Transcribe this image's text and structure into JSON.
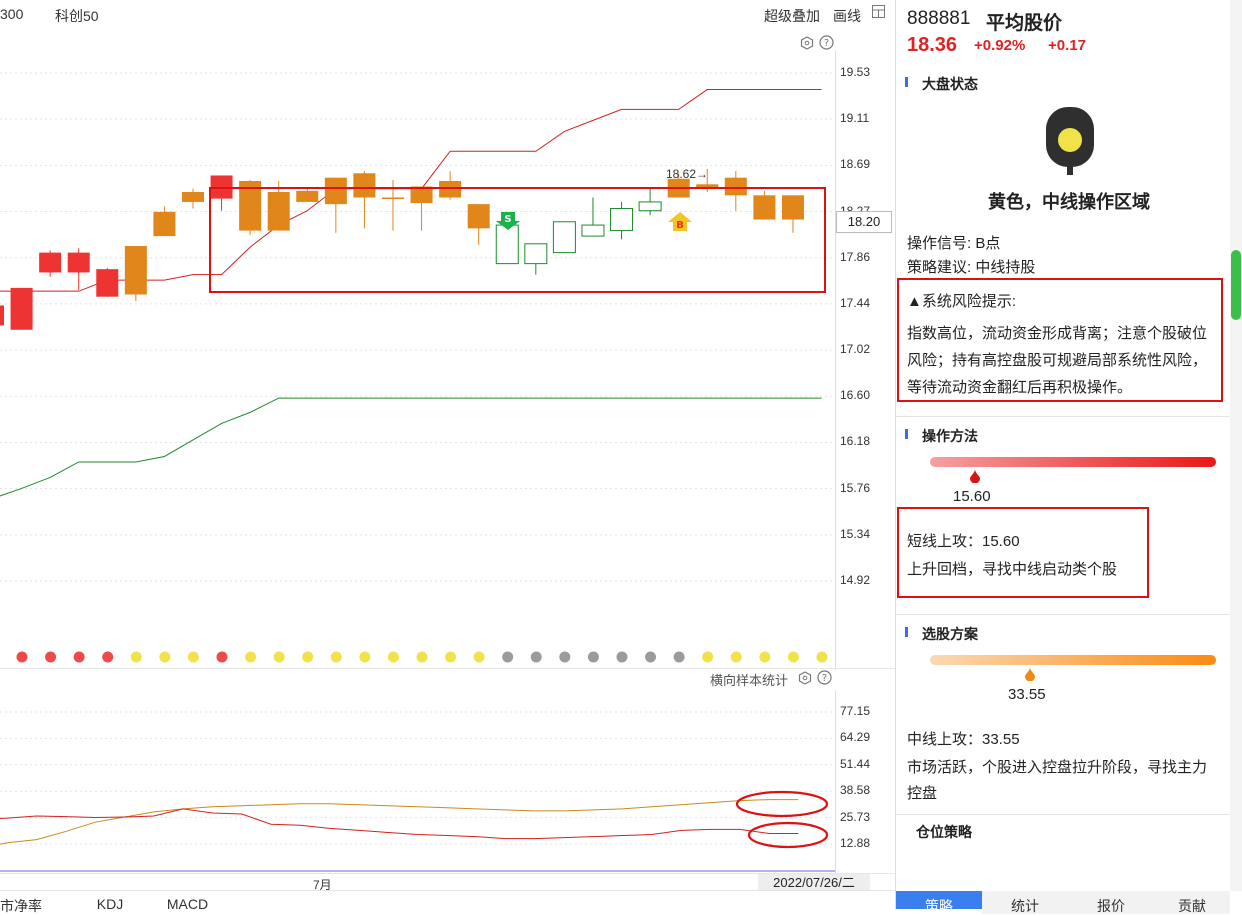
{
  "toolbar": {
    "left_cut": "300",
    "kechuang": "科创50",
    "overlay": "超级叠加",
    "draw": "画线"
  },
  "stock": {
    "code": "888881",
    "name": "平均股价",
    "price": "18.36",
    "pct": "+0.92%",
    "change": "+0.17"
  },
  "main_chart": {
    "y_ticks": [
      "19.53",
      "19.11",
      "18.69",
      "18.27",
      "17.86",
      "17.44",
      "17.02",
      "16.60",
      "16.18",
      "15.76",
      "15.34",
      "14.92"
    ],
    "current_price_label": "18.20",
    "high_annotation": "18.62→",
    "sell_marker": "S",
    "buy_marker": "B"
  },
  "chart_data": {
    "type": "candlestick",
    "ylim": [
      14.92,
      19.53
    ],
    "candles": [
      {
        "o": 17.42,
        "c": 17.24,
        "h": 17.44,
        "l": 17.18,
        "color": "red"
      },
      {
        "o": 17.2,
        "c": 17.58,
        "h": 17.58,
        "l": 17.2,
        "color": "red"
      },
      {
        "o": 17.72,
        "c": 17.9,
        "h": 17.92,
        "l": 17.68,
        "color": "red"
      },
      {
        "o": 17.72,
        "c": 17.9,
        "h": 17.94,
        "l": 17.56,
        "color": "red"
      },
      {
        "o": 17.5,
        "c": 17.75,
        "h": 17.76,
        "l": 17.5,
        "color": "red"
      },
      {
        "o": 17.52,
        "c": 17.96,
        "h": 17.96,
        "l": 17.46,
        "color": "orange"
      },
      {
        "o": 18.05,
        "c": 18.27,
        "h": 18.32,
        "l": 18.05,
        "color": "orange"
      },
      {
        "o": 18.36,
        "c": 18.45,
        "h": 18.48,
        "l": 18.3,
        "color": "orange"
      },
      {
        "o": 18.39,
        "c": 18.6,
        "h": 18.6,
        "l": 18.28,
        "color": "red"
      },
      {
        "o": 18.55,
        "c": 18.1,
        "h": 18.56,
        "l": 18.06,
        "color": "orange"
      },
      {
        "o": 18.45,
        "c": 18.1,
        "h": 18.55,
        "l": 18.1,
        "color": "orange"
      },
      {
        "o": 18.46,
        "c": 18.36,
        "h": 18.48,
        "l": 18.36,
        "color": "orange"
      },
      {
        "o": 18.58,
        "c": 18.34,
        "h": 18.58,
        "l": 18.08,
        "color": "orange"
      },
      {
        "o": 18.62,
        "c": 18.4,
        "h": 18.64,
        "l": 18.12,
        "color": "orange"
      },
      {
        "o": 18.4,
        "c": 18.4,
        "h": 18.56,
        "l": 18.1,
        "color": "orange_doji"
      },
      {
        "o": 18.5,
        "c": 18.35,
        "h": 18.5,
        "l": 18.1,
        "color": "orange"
      },
      {
        "o": 18.55,
        "c": 18.4,
        "h": 18.64,
        "l": 18.38,
        "color": "orange"
      },
      {
        "o": 18.34,
        "c": 18.12,
        "h": 18.34,
        "l": 17.97,
        "color": "orange"
      },
      {
        "o": 17.8,
        "c": 18.15,
        "h": 18.16,
        "l": 17.8,
        "color": "green"
      },
      {
        "o": 17.8,
        "c": 17.98,
        "h": 17.98,
        "l": 17.7,
        "color": "green"
      },
      {
        "o": 17.9,
        "c": 18.18,
        "h": 18.18,
        "l": 17.9,
        "color": "green"
      },
      {
        "o": 18.05,
        "c": 18.15,
        "h": 18.4,
        "l": 18.05,
        "color": "green"
      },
      {
        "o": 18.1,
        "c": 18.3,
        "h": 18.36,
        "l": 18.02,
        "color": "green"
      },
      {
        "o": 18.28,
        "c": 18.36,
        "h": 18.48,
        "l": 18.24,
        "color": "green"
      },
      {
        "o": 18.57,
        "c": 18.4,
        "h": 18.62,
        "l": 18.4,
        "color": "orange"
      },
      {
        "o": 18.52,
        "c": 18.49,
        "h": 18.66,
        "l": 18.45,
        "color": "orange_doji"
      },
      {
        "o": 18.58,
        "c": 18.42,
        "h": 18.64,
        "l": 18.28,
        "color": "orange"
      },
      {
        "o": 18.42,
        "c": 18.2,
        "h": 18.46,
        "l": 18.2,
        "color": "orange"
      },
      {
        "o": 18.42,
        "c": 18.2,
        "h": 18.42,
        "l": 18.08,
        "color": "orange"
      }
    ],
    "red_line": [
      17.55,
      17.55,
      17.55,
      17.55,
      17.65,
      17.65,
      17.65,
      17.7,
      17.7,
      17.95,
      18.15,
      18.28,
      18.48,
      18.48,
      18.48,
      18.48,
      18.82,
      18.82,
      18.82,
      18.82,
      19.0,
      19.1,
      19.2,
      19.2,
      19.2,
      19.38,
      19.38,
      19.38,
      19.38,
      19.38
    ],
    "green_line": [
      15.67,
      15.76,
      15.86,
      16.0,
      16.0,
      16.0,
      16.05,
      16.2,
      16.35,
      16.45,
      16.58,
      16.58,
      16.58,
      16.58,
      16.58,
      16.58,
      16.58,
      16.58,
      16.58,
      16.58,
      16.58,
      16.58,
      16.58,
      16.58,
      16.58,
      16.58,
      16.58,
      16.58,
      16.58,
      16.58
    ],
    "dots": [
      "red",
      "red",
      "red",
      "red",
      "yellow",
      "yellow",
      "yellow",
      "red",
      "yellow",
      "yellow",
      "yellow",
      "yellow",
      "yellow",
      "yellow",
      "yellow",
      "yellow",
      "yellow",
      "gray",
      "gray",
      "gray",
      "gray",
      "gray",
      "gray",
      "gray",
      "yellow",
      "yellow",
      "yellow",
      "yellow",
      "yellow"
    ],
    "sub_ylim": [
      12.88,
      77.15
    ],
    "sub_red": [
      25.0,
      25.5,
      26.5,
      26.2,
      25.8,
      26.0,
      26.5,
      30.0,
      28.0,
      27.5,
      22.5,
      22.0,
      20.5,
      19.5,
      18.5,
      17.5,
      17.0,
      16.5,
      15.5,
      15.5,
      16.0,
      16.5,
      17.0,
      17.5,
      19.5,
      20.0,
      20.0,
      18.0,
      18.0
    ],
    "sub_orange": [
      10.5,
      13.5,
      15.0,
      19.0,
      23.5,
      26.0,
      28.5,
      30.0,
      31.0,
      31.5,
      32.0,
      32.5,
      32.5,
      32.0,
      31.5,
      31.0,
      30.5,
      30.0,
      29.5,
      29.0,
      29.0,
      29.5,
      30.0,
      31.0,
      32.0,
      33.0,
      34.0,
      34.5,
      34.5
    ]
  },
  "sub_chart": {
    "title": "横向样本统计",
    "y_ticks": [
      "77.15",
      "64.29",
      "51.44",
      "38.58",
      "25.73",
      "12.88"
    ],
    "x_label": "7月",
    "date_label": "2022/07/26/二"
  },
  "bottom_tabs_left": [
    "市净率",
    "KDJ",
    "MACD"
  ],
  "panel": {
    "market_title": "大盘状态",
    "status_text": "黄色，中线操作区域",
    "signal": "操作信号: B点",
    "advice": "策略建议: 中线持股",
    "risk_title": "▲系统风险提示:",
    "risk_lines": [
      "指数高位，流动资金形成背离；注意个股破位",
      "风险；持有高控盘股可规避局部系统性风险，",
      "等待流动资金翻红后再积极操作。"
    ],
    "method_title": "操作方法",
    "method_value": "15.60",
    "method_line1": "短线上攻：15.60",
    "method_line2": "上升回档，寻找中线启动类个股",
    "pick_title": "选股方案",
    "pick_value": "33.55",
    "pick_line1": "中线上攻：33.55",
    "pick_line2": "市场活跃，个股进入控盘拉升阶段，寻找主力",
    "pick_line3": "控盘",
    "position_title": "仓位策略"
  },
  "bottom_tabs_right": [
    "策略",
    "统计",
    "报价",
    "贡献"
  ],
  "colors": {
    "up": "#ee3333",
    "orange": "#e0861a",
    "green": "#1a8a2a",
    "annot": "#dd1111",
    "tab_active": "#3a7ff0"
  }
}
